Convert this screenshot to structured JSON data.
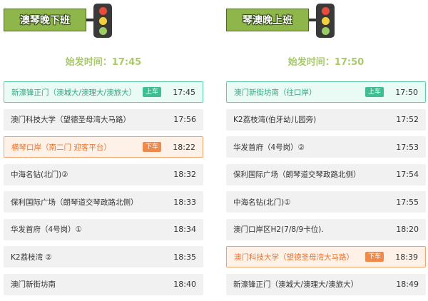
{
  "colors": {
    "title_green": "#8fb64a",
    "start_time": "#a9c96a",
    "board": "#3fbd95",
    "alight": "#f08a4b",
    "light_red": "#e84c3d",
    "light_yellow": "#f4d03f",
    "light_green": "#9ccc65"
  },
  "left": {
    "title": "澳琴晚下班",
    "start_time": "始发时间：17:45",
    "stops": [
      {
        "name": "新濠锋正门（澳城大/澳理大/澳旅大）",
        "badge": "上车",
        "time": "17:45"
      },
      {
        "name": "澳门科技大学（望德圣母湾大马路）",
        "badge": "",
        "time": "17:56"
      },
      {
        "name": "横琴口岸（南二门 迎客平台）",
        "badge": "下车",
        "time": "18:22"
      },
      {
        "name": "中海名钻(北门)②",
        "badge": "",
        "time": "18:32"
      },
      {
        "name": "保利国际广场（朗琴道交琴政路北侧）",
        "badge": "",
        "time": "18:33"
      },
      {
        "name": "华发首府（4号岗）①",
        "badge": "",
        "time": "18:34"
      },
      {
        "name": "K2荔枝湾 ②",
        "badge": "",
        "time": "18:35"
      },
      {
        "name": "澳门新街坊南",
        "badge": "",
        "time": "18:40"
      }
    ]
  },
  "right": {
    "title": "琴澳晚上班",
    "start_time": "始发时间：17:50",
    "stops": [
      {
        "name": "澳门新街坊南（往口岸）",
        "badge": "上车",
        "time": "17:50"
      },
      {
        "name": "K2荔枝湾(伯牙幼儿园旁)",
        "badge": "",
        "time": "17:52"
      },
      {
        "name": "华发首府（4号岗）②",
        "badge": "",
        "time": "17:53"
      },
      {
        "name": "保利国际广场（朗琴道交琴政路北侧）",
        "badge": "",
        "time": "17:54"
      },
      {
        "name": "中海名钻(北门)①",
        "badge": "",
        "time": "17:55"
      },
      {
        "name": "澳门口岸区H2(7/8/9卡位).",
        "badge": "",
        "time": "18:20"
      },
      {
        "name": "澳门科技大学（望德圣母湾大马路）",
        "badge": "下车",
        "time": "18:39"
      },
      {
        "name": "新濠锋正门（澳城大/澳理大/澳旅大）",
        "badge": "",
        "time": "18:49"
      }
    ]
  }
}
